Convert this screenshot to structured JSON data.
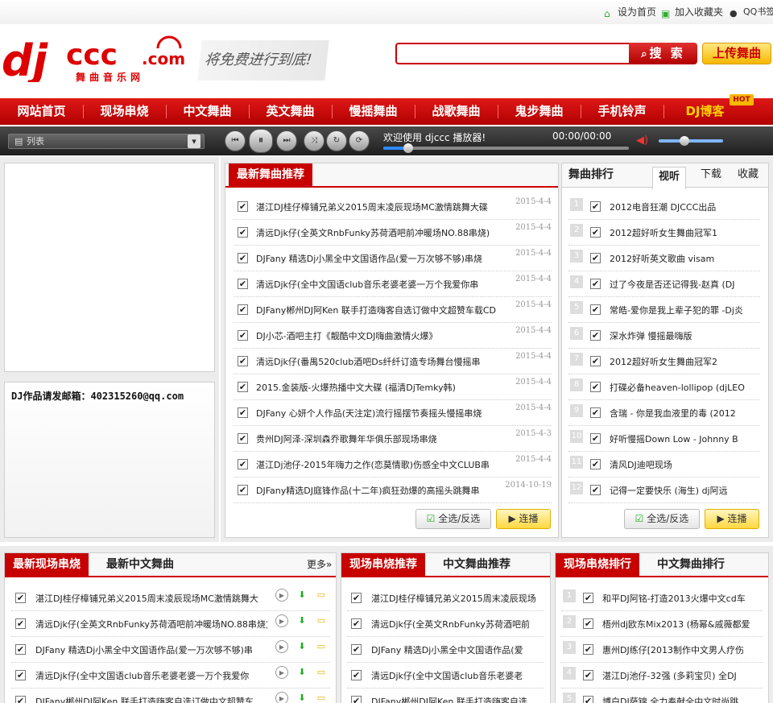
{
  "top": {
    "home": "设为首页",
    "fav": "加入收藏夹",
    "qq": "QQ书签"
  },
  "logo": {
    "main": "djccc",
    "dotcom": ".com",
    "sub": "舞曲音乐网"
  },
  "slogan": "将免费进行到底!",
  "search": {
    "value": "",
    "button": "搜 索"
  },
  "upload": "上传舞曲",
  "nav": [
    "网站首页",
    "现场串烧",
    "中文舞曲",
    "英文舞曲",
    "慢摇舞曲",
    "战歌舞曲",
    "鬼步舞曲",
    "手机铃声",
    "DJ博客"
  ],
  "hot": "HOT",
  "player": {
    "playlist": "列表",
    "welcome": "欢迎使用 djccc 播放器!",
    "time": "00:00/00:00",
    "progress": 0.1,
    "volume": 0.4
  },
  "email": "DJ作品请发邮箱：402315260@qq.com",
  "latest": {
    "tab": "最新舞曲推荐",
    "items": [
      {
        "title": "湛江DJ桂仔樟铺兄弟义2015周末凌辰现场MC激情跳舞大碟",
        "date": "2015-4-4"
      },
      {
        "title": "清远Djk仔(全英文RnbFunky苏荷酒吧前冲暖场NO.88串烧)",
        "date": "2015-4-4"
      },
      {
        "title": "DJFany 精选Dj小黑全中文国语作品(爱一万次够不够)串烧",
        "date": "2015-4-4"
      },
      {
        "title": "清远Djk仔(全中文国语club音乐老婆老婆一万个我爱你串",
        "date": "2015-4-4"
      },
      {
        "title": "DJFany郴州DJ阿Ken 联手打造嗨客自选订做中文超赞车载CD",
        "date": "2015-4-4"
      },
      {
        "title": "DJ小芯-酒吧主打《靓酷中文DJ嗨曲激情火爆》",
        "date": "2015-4-4"
      },
      {
        "title": "清远Djk仔(番禺520club酒吧Ds纤纤订造专场舞台慢摇串",
        "date": "2015-4-4"
      },
      {
        "title": "2015.金装版-火爆热播中文大碟 (福清DjTemky韩)",
        "date": "2015-4-4"
      },
      {
        "title": "DJFany 心妍个人作品(天注定)流行摇摆节奏摇头慢摇串烧",
        "date": "2015-4-4"
      },
      {
        "title": "贵州DJ阿泽-深圳森乔歌舞年华俱乐部现场串烧",
        "date": "2015-4-3"
      },
      {
        "title": "湛江Dj池仔-2015年嗨力之作(恋莫情歌)伤感全中文CLUB串",
        "date": "2015-4-4"
      },
      {
        "title": "DJFany精选DJ庭锋作品(十二年)疯狂劲爆的高摇头跳舞串",
        "date": "2014-10-19"
      }
    ],
    "select_all": "全选/反选",
    "play": "连播"
  },
  "rank": {
    "title": "舞曲排行",
    "tabs": [
      "视听",
      "下载",
      "收藏"
    ],
    "items": [
      {
        "n": "1",
        "title": "2012电音狂潮 DJCCC出品"
      },
      {
        "n": "2",
        "title": "2012超好听女生舞曲冠军1"
      },
      {
        "n": "3",
        "title": "2012好听英文歌曲 visam"
      },
      {
        "n": "4",
        "title": "过了今夜是否还记得我-赵真 (DJ"
      },
      {
        "n": "5",
        "title": "常皓-爱你是我上辈子犯的罪 -Dj炎"
      },
      {
        "n": "6",
        "title": "深水炸弹 慢摇最嗨版"
      },
      {
        "n": "7",
        "title": "2012超好听女生舞曲冠军2"
      },
      {
        "n": "8",
        "title": "打碟必备heaven-lollipop (djLEO"
      },
      {
        "n": "9",
        "title": "含瑞 - 你是我血液里的毒 (2012"
      },
      {
        "n": "10",
        "title": "好听慢摇Down Low - Johnny B"
      },
      {
        "n": "11",
        "title": "清风DJ迪吧现场"
      },
      {
        "n": "12",
        "title": "记得一定要快乐 (海生) dj阿远"
      }
    ],
    "select_all": "全选/反选",
    "play": "连播"
  },
  "bottom1": {
    "tab_active": "最新现场串烧",
    "tab2": "最新中文舞曲",
    "more": "更多»",
    "items": [
      "湛江DJ桂仔樟铺兄弟义2015周末凌辰现场MC激情跳舞大",
      "清远Djk仔(全英文RnbFunky苏荷酒吧前冲暖场NO.88串烧)",
      "DJFany 精选Dj小黑全中文国语作品(爱一万次够不够)串",
      "清远Djk仔(全中文国语club音乐老婆老婆一万个我爱你",
      "DJFany郴州DJ阿Ken 联手打造嗨客自选订做中文超赞车"
    ]
  },
  "bottom2": {
    "tab_active": "现场串烧推荐",
    "tab2": "中文舞曲推荐",
    "items": [
      "湛江DJ桂仔樟铺兄弟义2015周末凌辰现场",
      "清远Djk仔(全英文RnbFunky苏荷酒吧前",
      "DJFany 精选Dj小黑全中文国语作品(爱",
      "清远Djk仔(全中文国语club音乐老婆老",
      "DJFany郴州DJ阿Ken 联手打造嗨客自选"
    ]
  },
  "bottom3": {
    "tab_active": "现场串烧排行",
    "tab2": "中文舞曲排行",
    "items": [
      {
        "n": "1",
        "title": "和平DJ阿铭-打造2013火爆中文cd车"
      },
      {
        "n": "2",
        "title": "梧州dj欧东Mix2013 (杨幂&戚薇都爱"
      },
      {
        "n": "3",
        "title": "惠州DJ练仔[2013制作中文男人疗伤"
      },
      {
        "n": "4",
        "title": "湛江Dj池仔-32强 (多莉宝贝) 全DJ"
      },
      {
        "n": "5",
        "title": "博白DJ萨锦 全力奉献全中文时尚跳"
      }
    ]
  }
}
